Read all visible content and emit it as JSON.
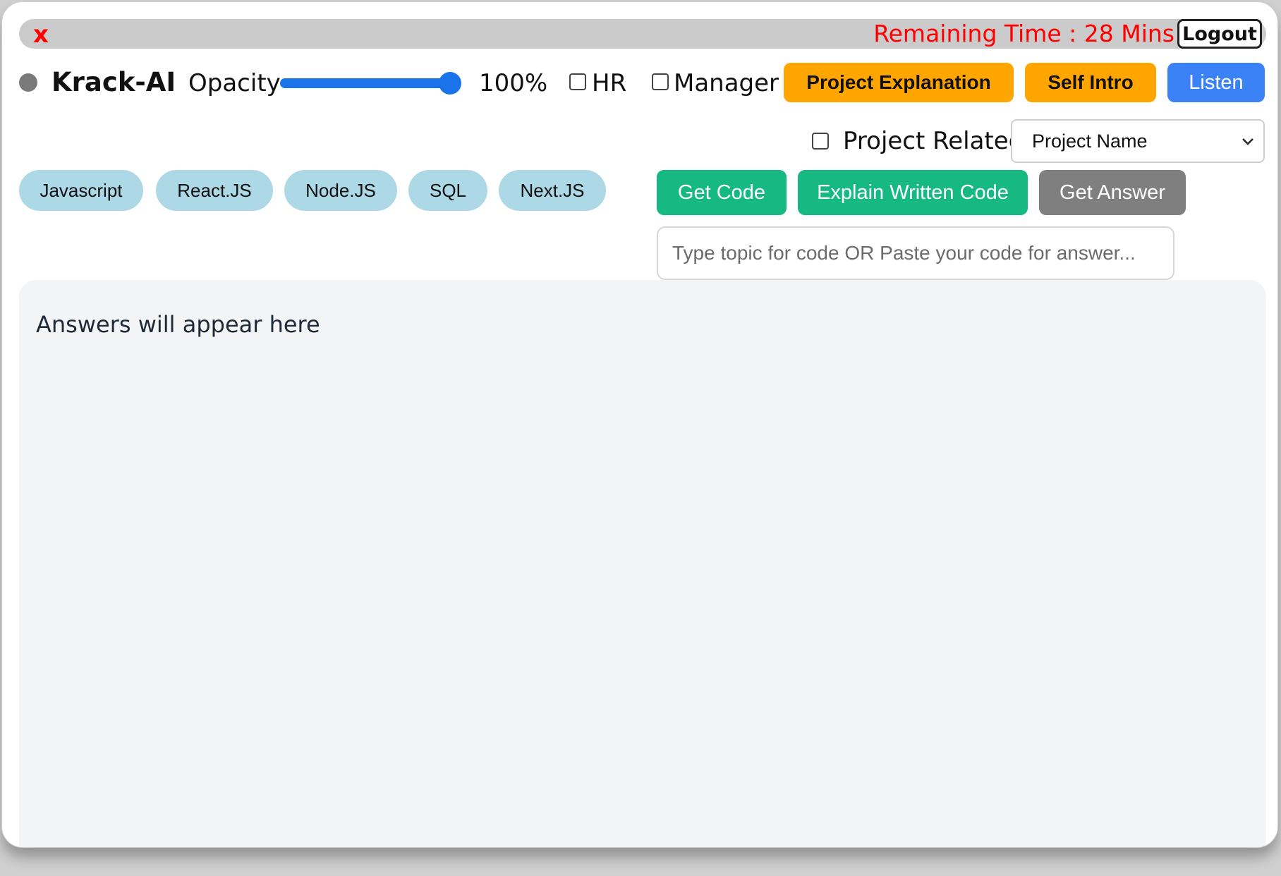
{
  "titlebar": {
    "close_icon": "close-icon",
    "close_glyph": "x",
    "remaining_time": "Remaining Time : 28 Mins",
    "logout_label": "Logout"
  },
  "toolbar": {
    "status_dot_color": "#7a7a7a",
    "brand": "Krack-AI",
    "opacity_label": "Opacity",
    "opacity_value": "100%",
    "opacity_level": 1.0,
    "hr_label": "HR",
    "hr_checked": false,
    "manager_label": "Manager",
    "manager_checked": false,
    "project_explanation_label": "Project Explanation",
    "self_intro_label": "Self Intro",
    "listen_label": "Listen"
  },
  "project": {
    "related_label": "Project Related",
    "related_checked": false,
    "select_value": "Project Name"
  },
  "topics": [
    "Javascript",
    "React.JS",
    "Node.JS",
    "SQL",
    "Next.JS"
  ],
  "actions": {
    "get_code_label": "Get Code",
    "explain_label": "Explain Written Code",
    "get_answer_label": "Get Answer"
  },
  "input": {
    "placeholder": "Type topic for code OR Paste your code for answer...",
    "value": ""
  },
  "answers": {
    "placeholder_text": "Answers will appear here"
  },
  "colors": {
    "danger": "#ff0000",
    "orange": "#ffa500",
    "blue": "#3b82f6",
    "green": "#16b981",
    "gray": "#7f7f7f",
    "pill": "#add8e6"
  }
}
